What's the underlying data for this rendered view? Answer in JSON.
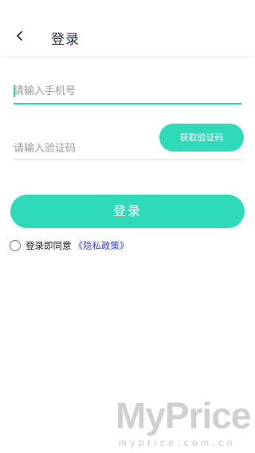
{
  "header": {
    "title": "登录",
    "back_icon": "chevron-left-icon"
  },
  "form": {
    "phone_placeholder": "请输入手机号",
    "phone_value": "",
    "code_placeholder": "请输入验证码",
    "code_value": "",
    "get_code_label": "获取验证码",
    "submit_label": "登录"
  },
  "agreement": {
    "text": "登录即同意",
    "policy_link": "《隐私政策》",
    "checked": false
  },
  "watermark": {
    "brand": "MyPrice",
    "domain": "myprice.com.cn"
  },
  "colors": {
    "accent": "#2fdab9",
    "link": "#2b3fd6"
  }
}
